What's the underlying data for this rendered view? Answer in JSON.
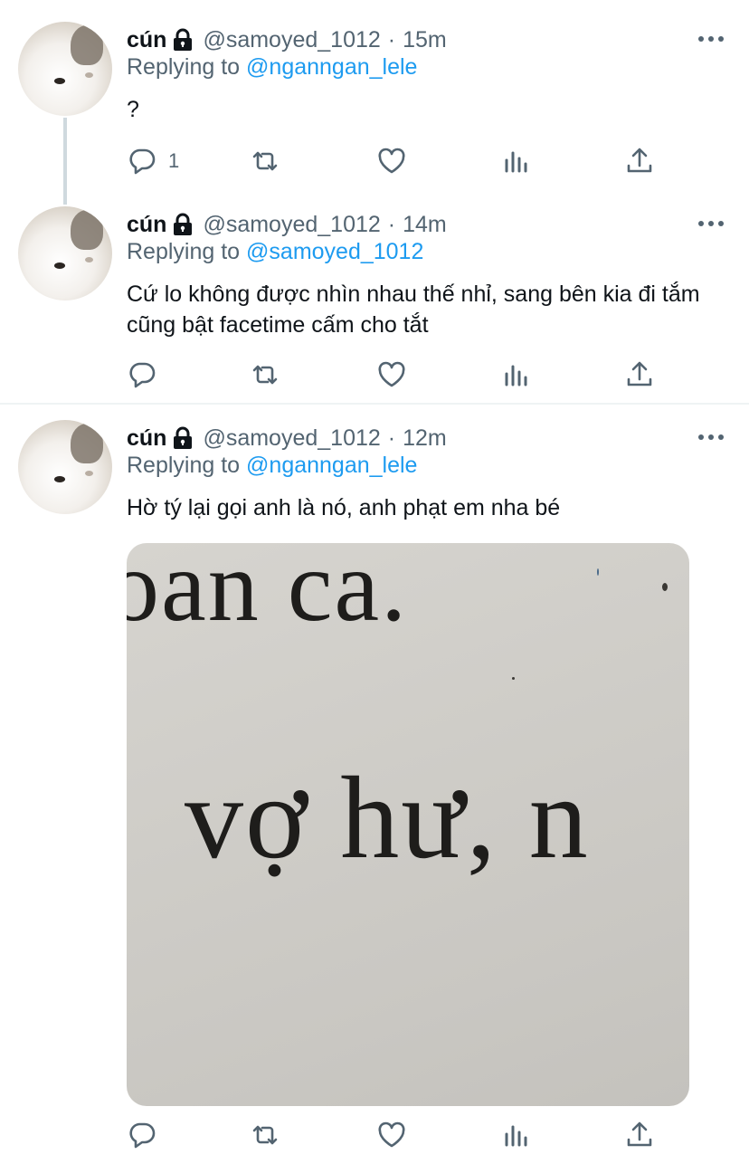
{
  "tweets": [
    {
      "name": "cún",
      "handle": "@samoyed_1012",
      "separator": "·",
      "time": "15m",
      "replying_prefix": "Replying to",
      "replying_to": "@nganngan_lele",
      "text": "?",
      "reply_count": "1"
    },
    {
      "name": "cún",
      "handle": "@samoyed_1012",
      "separator": "·",
      "time": "14m",
      "replying_prefix": "Replying to",
      "replying_to": "@samoyed_1012",
      "text": "Cứ lo không được nhìn nhau thế nhỉ, sang bên kia đi tắm cũng bật facetime cấm cho tắt",
      "reply_count": ""
    },
    {
      "name": "cún",
      "handle": "@samoyed_1012",
      "separator": "·",
      "time": "12m",
      "replying_prefix": "Replying to",
      "replying_to": "@nganngan_lele",
      "text": "Hờ tý lại gọi anh là nó, anh phạt em nha bé",
      "reply_count": "",
      "media": {
        "line1": "oan ca.",
        "line2": "vợ hư, n"
      }
    }
  ],
  "icons": {
    "lock": "lock-icon",
    "more": "more-icon",
    "reply": "reply-icon",
    "retweet": "retweet-icon",
    "like": "like-icon",
    "analytics": "analytics-icon",
    "share": "share-icon"
  },
  "colors": {
    "text_primary": "#0f1419",
    "text_secondary": "#536471",
    "link": "#1d9bf0",
    "thread_line": "#cfd9de",
    "divider": "#eff3f4"
  }
}
